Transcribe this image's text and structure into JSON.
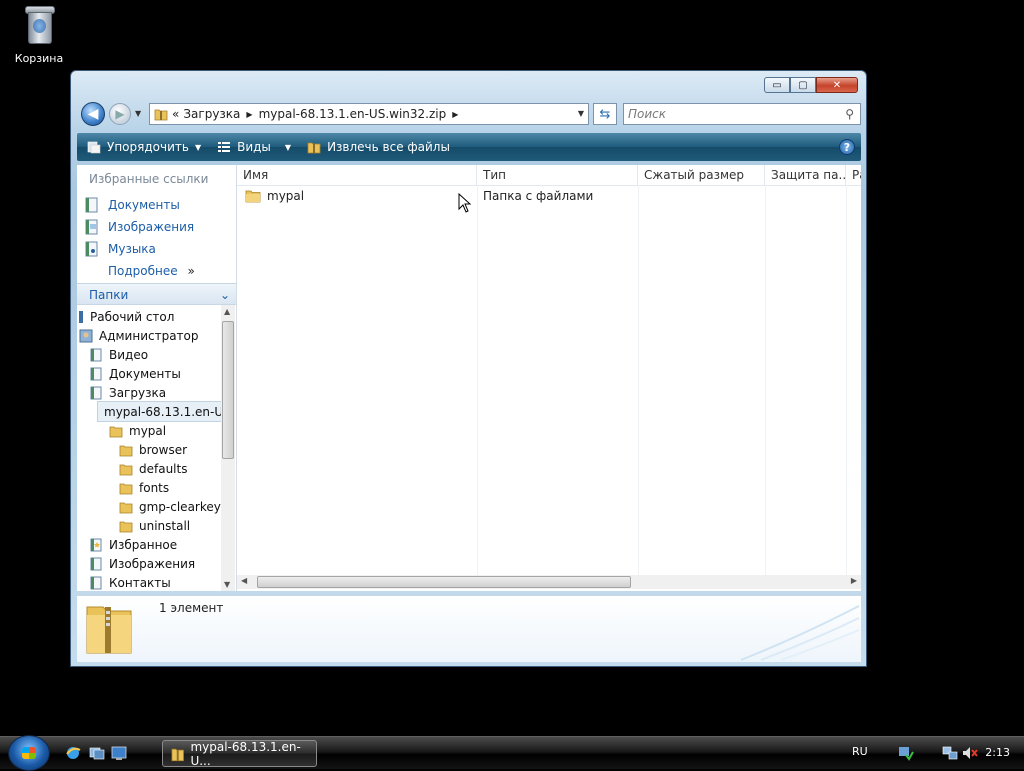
{
  "desktop": {
    "recycle_bin_label": "Корзина"
  },
  "window": {
    "caption_min": "▭",
    "caption_max": "▢",
    "caption_close": "✕"
  },
  "address": {
    "chevron": "«",
    "crumbs": [
      "Загрузка",
      "mypal-68.13.1.en-US.win32.zip"
    ]
  },
  "search": {
    "placeholder": "Поиск"
  },
  "toolbar": {
    "organize": "Упорядочить",
    "views": "Виды",
    "extract_all": "Извлечь все файлы",
    "help": "?"
  },
  "navpane": {
    "favorites_title": "Избранные ссылки",
    "favorites": [
      {
        "label": "Документы",
        "icon": "documents-icon"
      },
      {
        "label": "Изображения",
        "icon": "pictures-icon"
      },
      {
        "label": "Музыка",
        "icon": "music-icon"
      }
    ],
    "more": "Подробнее",
    "more_chevron": "»",
    "folders_title": "Папки",
    "folders_chevron": "⌄",
    "tree": [
      {
        "label": "Рабочий стол"
      },
      {
        "label": "Администратор"
      },
      {
        "label": "Видео"
      },
      {
        "label": "Документы"
      },
      {
        "label": "Загрузка"
      },
      {
        "label": "mypal-68.13.1.en-U"
      },
      {
        "label": "mypal"
      },
      {
        "label": "browser"
      },
      {
        "label": "defaults"
      },
      {
        "label": "fonts"
      },
      {
        "label": "gmp-clearkey"
      },
      {
        "label": "uninstall"
      },
      {
        "label": "Избранное"
      },
      {
        "label": "Изображения"
      },
      {
        "label": "Контакты"
      }
    ]
  },
  "filelist": {
    "columns": [
      "Имя",
      "Тип",
      "Сжатый размер",
      "Защита па...",
      "Ра"
    ],
    "rows": [
      {
        "name": "mypal",
        "type": "Папка с файлами"
      }
    ]
  },
  "details": {
    "count": "1 элемент"
  },
  "taskbar": {
    "task_label": "mypal-68.13.1.en-U...",
    "language": "RU",
    "clock": "2:13"
  },
  "colors": {
    "toolbar": "#1e5a7b",
    "link": "#1d5ea8",
    "folder": "#e9c25a"
  }
}
